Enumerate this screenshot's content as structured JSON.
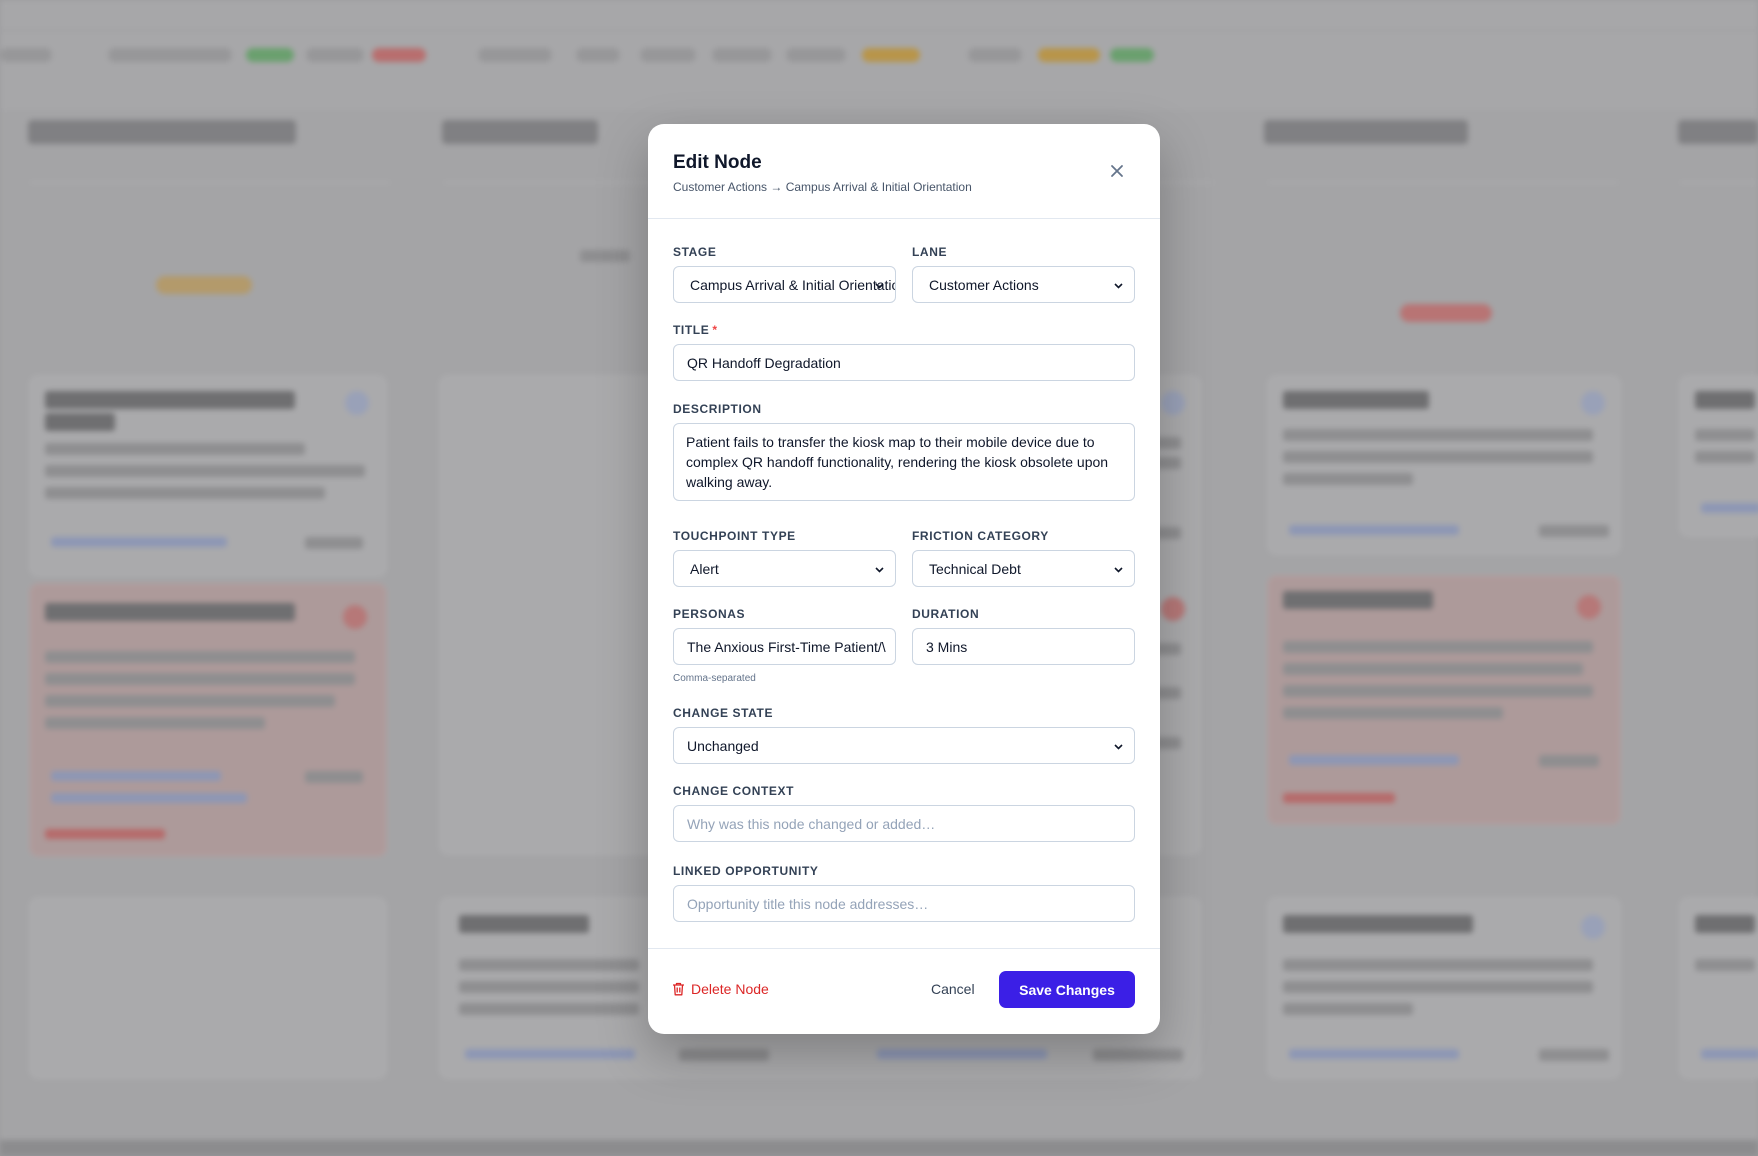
{
  "modal": {
    "title": "Edit Node",
    "subtitle": "Customer Actions → Campus Arrival & Initial Orientation",
    "close_icon": "close-icon"
  },
  "form": {
    "stage": {
      "label": "STAGE",
      "value": "Campus Arrival & Initial Orientation"
    },
    "lane": {
      "label": "LANE",
      "value": "Customer Actions"
    },
    "title": {
      "label": "TITLE",
      "required_mark": "*",
      "value": "QR Handoff Degradation"
    },
    "description": {
      "label": "DESCRIPTION",
      "value": "Patient fails to transfer the kiosk map to their mobile device due to complex QR handoff functionality, rendering the kiosk obsolete upon walking away."
    },
    "touchpoint_type": {
      "label": "TOUCHPOINT TYPE",
      "value": "Alert"
    },
    "friction_category": {
      "label": "FRICTION CATEGORY",
      "value": "Technical Debt"
    },
    "personas": {
      "label": "PERSONAS",
      "value": "The Anxious First-Time Patient/\\",
      "hint": "Comma-separated"
    },
    "duration": {
      "label": "DURATION",
      "value": "3 Mins"
    },
    "change_state": {
      "label": "CHANGE STATE",
      "value": "Unchanged"
    },
    "change_context": {
      "label": "CHANGE CONTEXT",
      "placeholder": "Why was this node changed or added…"
    },
    "linked_opportunity": {
      "label": "LINKED OPPORTUNITY",
      "placeholder": "Opportunity title this node addresses…"
    }
  },
  "footer": {
    "delete_label": "Delete Node",
    "cancel_label": "Cancel",
    "save_label": "Save Changes"
  },
  "colors": {
    "accent": "#3b1fe6",
    "danger": "#dc2626",
    "required": "#ef4444"
  }
}
